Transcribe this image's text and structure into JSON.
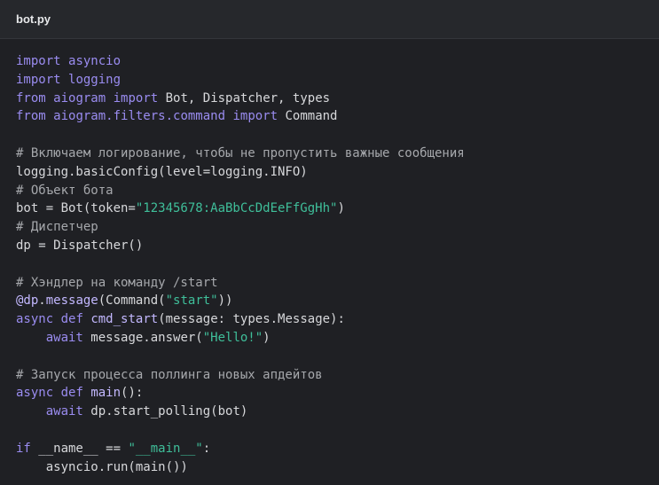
{
  "header": {
    "filename": "bot.py"
  },
  "code_lines": [
    [
      [
        "kw",
        "import"
      ],
      [
        "plain",
        " "
      ],
      [
        "kw",
        "asyncio"
      ]
    ],
    [
      [
        "kw",
        "import"
      ],
      [
        "plain",
        " "
      ],
      [
        "kw",
        "logging"
      ]
    ],
    [
      [
        "kw",
        "from"
      ],
      [
        "plain",
        " "
      ],
      [
        "kw",
        "aiogram"
      ],
      [
        "plain",
        " "
      ],
      [
        "kw",
        "import"
      ],
      [
        "plain",
        " Bot, Dispatcher, types"
      ]
    ],
    [
      [
        "kw",
        "from"
      ],
      [
        "plain",
        " "
      ],
      [
        "kw",
        "aiogram.filters.command"
      ],
      [
        "plain",
        " "
      ],
      [
        "kw",
        "import"
      ],
      [
        "plain",
        " Command"
      ]
    ],
    [],
    [
      [
        "cmt",
        "# Включаем логирование, чтобы не пропустить важные сообщения"
      ]
    ],
    [
      [
        "plain",
        "logging.basicConfig(level=logging.INFO)"
      ]
    ],
    [
      [
        "cmt",
        "# Объект бота"
      ]
    ],
    [
      [
        "plain",
        "bot = Bot(token="
      ],
      [
        "str",
        "\"12345678:AaBbCcDdEeFfGgHh\""
      ],
      [
        "plain",
        ")"
      ]
    ],
    [
      [
        "cmt",
        "# Диспетчер"
      ]
    ],
    [
      [
        "plain",
        "dp = Dispatcher()"
      ]
    ],
    [],
    [
      [
        "cmt",
        "# Хэндлер на команду /start"
      ]
    ],
    [
      [
        "fn",
        "@dp"
      ],
      [
        "plain",
        "."
      ],
      [
        "fn",
        "message"
      ],
      [
        "plain",
        "(Command("
      ],
      [
        "str",
        "\"start\""
      ],
      [
        "plain",
        "))"
      ]
    ],
    [
      [
        "kw",
        "async"
      ],
      [
        "plain",
        " "
      ],
      [
        "kw",
        "def"
      ],
      [
        "plain",
        " "
      ],
      [
        "fn",
        "cmd_start"
      ],
      [
        "plain",
        "(message: types.Message):"
      ]
    ],
    [
      [
        "plain",
        "    "
      ],
      [
        "kw",
        "await"
      ],
      [
        "plain",
        " message.answer("
      ],
      [
        "str",
        "\"Hello!\""
      ],
      [
        "plain",
        ")"
      ]
    ],
    [],
    [
      [
        "cmt",
        "# Запуск процесса поллинга новых апдейтов"
      ]
    ],
    [
      [
        "kw",
        "async"
      ],
      [
        "plain",
        " "
      ],
      [
        "kw",
        "def"
      ],
      [
        "plain",
        " "
      ],
      [
        "fn",
        "main"
      ],
      [
        "plain",
        "():"
      ]
    ],
    [
      [
        "plain",
        "    "
      ],
      [
        "kw",
        "await"
      ],
      [
        "plain",
        " dp.start_polling(bot)"
      ]
    ],
    [],
    [
      [
        "kw",
        "if"
      ],
      [
        "plain",
        " __name__ == "
      ],
      [
        "str",
        "\"__main__\""
      ],
      [
        "plain",
        ":"
      ]
    ],
    [
      [
        "plain",
        "    asyncio.run(main())"
      ]
    ]
  ]
}
